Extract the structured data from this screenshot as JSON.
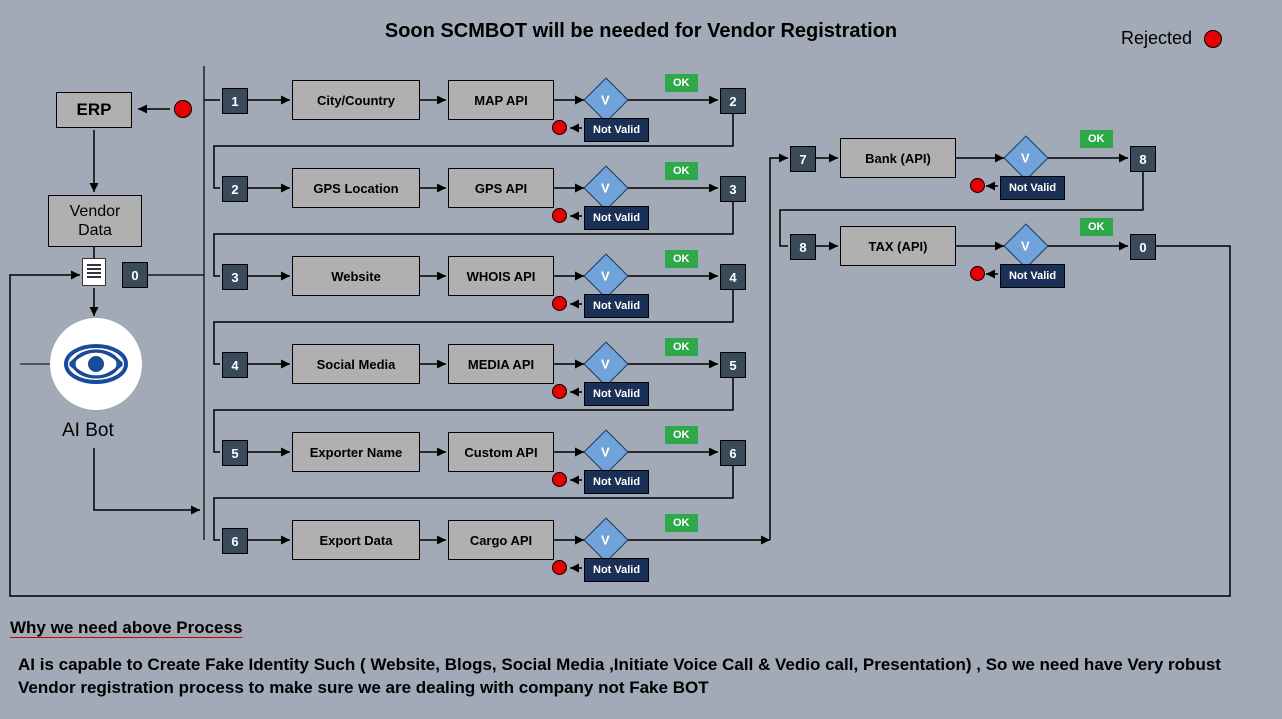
{
  "title": "Soon  SCMBOT will be needed for Vendor Registration",
  "legend": {
    "rejected": "Rejected"
  },
  "left": {
    "erp": "ERP",
    "vendor_line1": "Vendor",
    "vendor_line2": "Data",
    "ai_label": "AI Bot",
    "zero": "0"
  },
  "rows": [
    {
      "n_in": "1",
      "label": "City/Country",
      "api": "MAP API",
      "v": "V",
      "ok": "OK",
      "nv": "Not Valid",
      "n_out": "2"
    },
    {
      "n_in": "2",
      "label": "GPS Location",
      "api": "GPS API",
      "v": "V",
      "ok": "OK",
      "nv": "Not Valid",
      "n_out": "3"
    },
    {
      "n_in": "3",
      "label": "Website",
      "api": "WHOIS API",
      "v": "V",
      "ok": "OK",
      "nv": "Not Valid",
      "n_out": "4"
    },
    {
      "n_in": "4",
      "label": "Social Media",
      "api": "MEDIA API",
      "v": "V",
      "ok": "OK",
      "nv": "Not Valid",
      "n_out": "5"
    },
    {
      "n_in": "5",
      "label": "Exporter Name",
      "api": "Custom API",
      "v": "V",
      "ok": "OK",
      "nv": "Not Valid",
      "n_out": "6"
    },
    {
      "n_in": "6",
      "label": "Export Data",
      "api": "Cargo API",
      "v": "V",
      "ok": "OK",
      "nv": "Not Valid",
      "n_out": ""
    }
  ],
  "right": [
    {
      "n_in": "7",
      "label": "Bank (API)",
      "v": "V",
      "ok": "OK",
      "nv": "Not Valid",
      "n_out": "8"
    },
    {
      "n_in": "8",
      "label": "TAX (API)",
      "v": "V",
      "ok": "OK",
      "nv": "Not Valid",
      "n_out": "0"
    }
  ],
  "footer": {
    "heading": "Why we need above Process",
    "body": "AI is capable to Create Fake Identity Such ( Website, Blogs, Social Media ,Initiate Voice Call & Vedio call, Presentation) , So we need have Very robust Vendor registration process to make sure we are dealing with company not  Fake BOT"
  }
}
